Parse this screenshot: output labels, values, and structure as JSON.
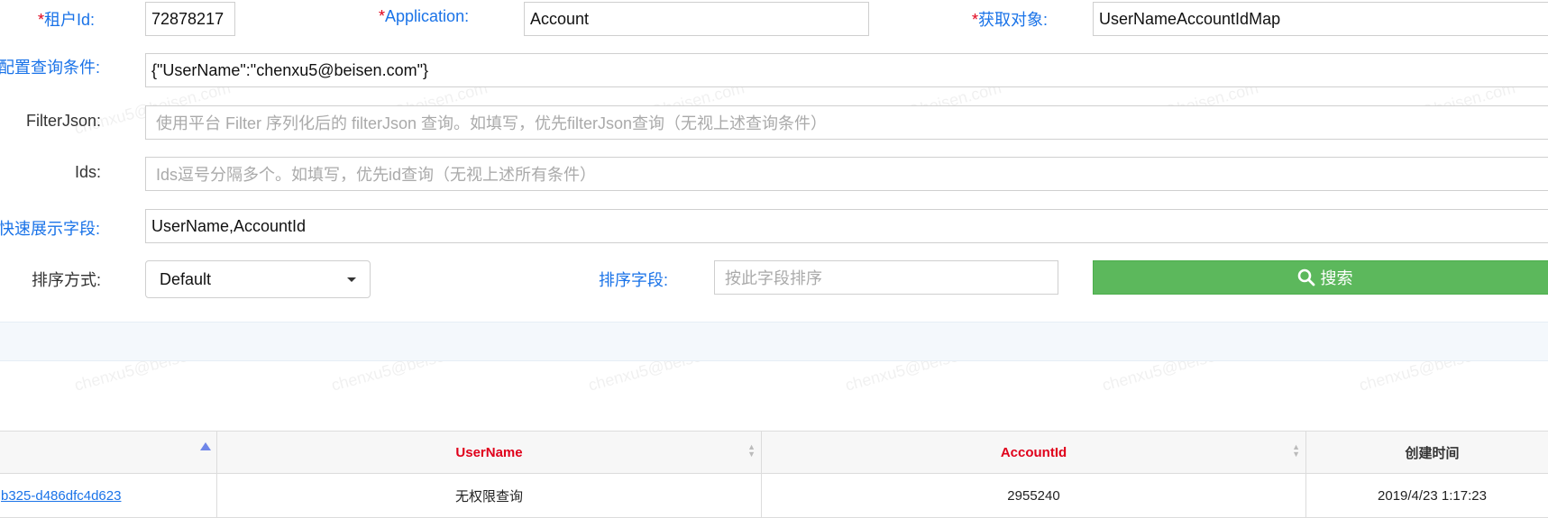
{
  "form": {
    "tenant_label": "租户Id:",
    "tenant_value": "72878217",
    "application_label": "Application:",
    "application_value": "Account",
    "target_label": "获取对象:",
    "target_value": "UserNameAccountIdMap",
    "query_label": "配置查询条件:",
    "query_value": "{\"UserName\":\"chenxu5@beisen.com\"}",
    "filterjson_label": "FilterJson:",
    "filterjson_placeholder": "使用平台 Filter 序列化后的 filterJson 查询。如填写，优先filterJson查询（无视上述查询条件）",
    "ids_label": "Ids:",
    "ids_placeholder": "Ids逗号分隔多个。如填写，优先id查询（无视上述所有条件）",
    "fields_label": "快速展示字段:",
    "fields_value": "UserName,AccountId",
    "sort_mode_label": "排序方式:",
    "sort_mode_value": "Default",
    "sort_field_label": "排序字段:",
    "sort_field_placeholder": "按此字段排序",
    "search_button": "搜索"
  },
  "table": {
    "headers": [
      "",
      "UserName",
      "AccountId",
      "创建时间"
    ],
    "rows": [
      [
        "b325-d486dfc4d623",
        "无权限查询",
        "2955240",
        "2019/4/23 1:17:23"
      ]
    ]
  },
  "watermark": "chenxu5@beisen.com",
  "colors": {
    "label_blue": "#1a73e8",
    "required_red": "#e0001b",
    "search_green": "#5cb85c"
  }
}
